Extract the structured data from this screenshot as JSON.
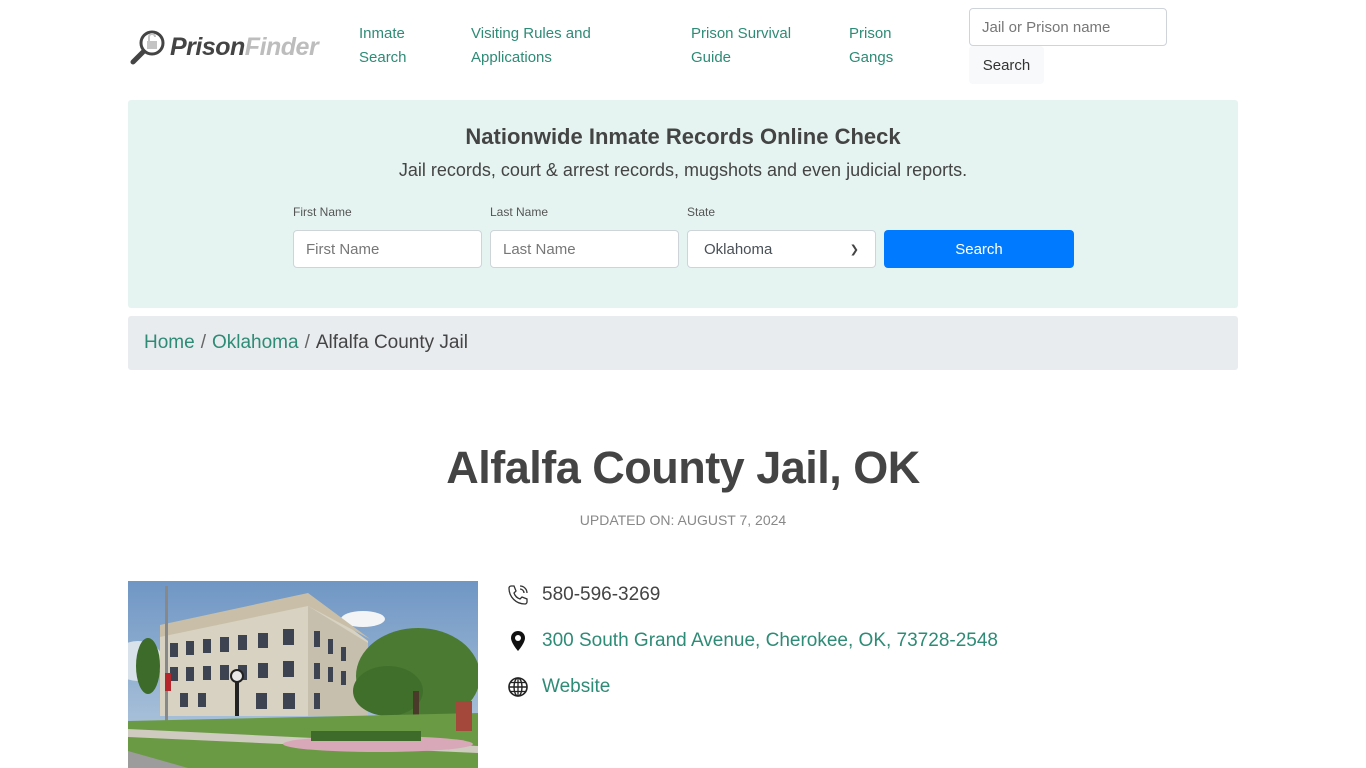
{
  "header": {
    "logo": {
      "part1": "Prison",
      "part2": "Finder",
      "icon": "magnifier-lock-icon"
    },
    "nav": [
      {
        "label_line1": "Inmate",
        "label_line2": "Search"
      },
      {
        "label_line1": "Visiting Rules and",
        "label_line2": "Applications"
      },
      {
        "label_line1": "Prison Survival",
        "label_line2": "Guide"
      },
      {
        "label_line1": "Prison",
        "label_line2": "Gangs"
      }
    ],
    "search": {
      "placeholder": "Jail or Prison name",
      "value": "",
      "button_label": "Search"
    }
  },
  "hero": {
    "title": "Nationwide Inmate Records Online Check",
    "subtitle": "Jail records, court & arrest records, mugshots and even judicial reports.",
    "first_name": {
      "label": "First Name",
      "placeholder": "First Name",
      "value": ""
    },
    "last_name": {
      "label": "Last Name",
      "placeholder": "Last Name",
      "value": ""
    },
    "state": {
      "label": "State",
      "selected": "Oklahoma"
    },
    "button_label": "Search",
    "button_color": "#007bff",
    "background_color": "#e5f4f1"
  },
  "breadcrumb": {
    "items": [
      {
        "label": "Home",
        "link": true
      },
      {
        "label": "Oklahoma",
        "link": true
      },
      {
        "label": "Alfalfa County Jail",
        "link": false
      }
    ],
    "separator": "/"
  },
  "page": {
    "title": "Alfalfa County Jail, OK",
    "updated": "UPDATED ON: AUGUST 7, 2024"
  },
  "contact": {
    "phone": {
      "icon": "phone-icon",
      "value": "580-596-3269"
    },
    "address": {
      "icon": "map-pin-icon",
      "value": "300 South Grand Avenue, Cherokee, OK, 73728-2548"
    },
    "website": {
      "icon": "globe-icon",
      "value": "Website"
    }
  },
  "colors": {
    "link": "#2e8b76",
    "text": "#444444",
    "breadcrumb_bg": "#e9ecef"
  }
}
